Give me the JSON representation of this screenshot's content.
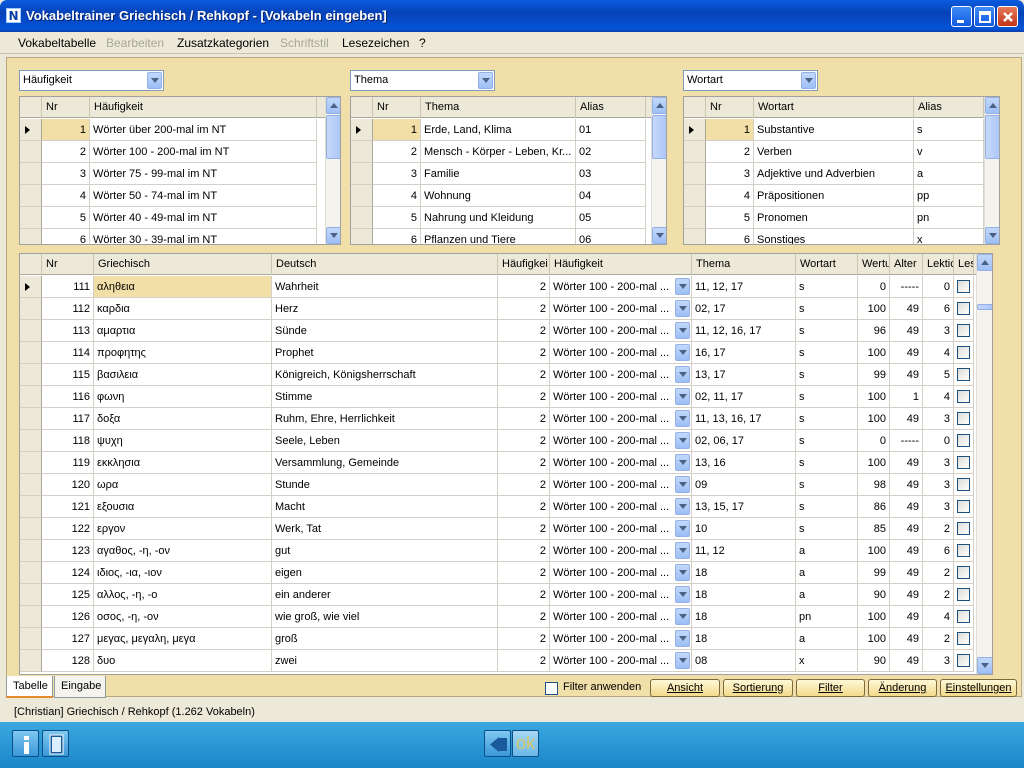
{
  "window": {
    "title": "Vokabeltrainer Griechisch / Rehkopf - [Vokabeln eingeben]",
    "icon": "app-n-icon"
  },
  "menu": [
    "Vokabeltabelle",
    "Bearbeiten",
    "Zusatzkategorien",
    "Schriftstil",
    "Lesezeichen",
    "?"
  ],
  "menu_disabled": [
    false,
    true,
    false,
    true,
    false,
    false
  ],
  "panels": [
    {
      "combo": "Häufigkeit",
      "headers": [
        "Nr",
        "Häufigkeit"
      ],
      "rows": [
        [
          "1",
          "Wörter über 200-mal im NT"
        ],
        [
          "2",
          "Wörter 100 - 200-mal im NT"
        ],
        [
          "3",
          "Wörter 75 - 99-mal im NT"
        ],
        [
          "4",
          "Wörter 50 - 74-mal im NT"
        ],
        [
          "5",
          "Wörter 40 - 49-mal im NT"
        ],
        [
          "6",
          "Wörter 30 - 39-mal im NT"
        ]
      ]
    },
    {
      "combo": "Thema",
      "headers": [
        "Nr",
        "Thema",
        "Alias"
      ],
      "rows": [
        [
          "1",
          "Erde, Land, Klima",
          "01"
        ],
        [
          "2",
          "Mensch - Körper - Leben, Kr...",
          "02"
        ],
        [
          "3",
          "Familie",
          "03"
        ],
        [
          "4",
          "Wohnung",
          "04"
        ],
        [
          "5",
          "Nahrung und Kleidung",
          "05"
        ],
        [
          "6",
          "Pflanzen und Tiere",
          "06"
        ]
      ]
    },
    {
      "combo": "Wortart",
      "headers": [
        "Nr",
        "Wortart",
        "Alias"
      ],
      "rows": [
        [
          "1",
          "Substantive",
          "s"
        ],
        [
          "2",
          "Verben",
          "v"
        ],
        [
          "3",
          "Adjektive und Adverbien",
          "a"
        ],
        [
          "4",
          "Präpositionen",
          "pp"
        ],
        [
          "5",
          "Pronomen",
          "pn"
        ],
        [
          "6",
          "Sonstiges",
          "x"
        ]
      ]
    }
  ],
  "main_grid": {
    "headers": [
      "Nr",
      "Griechisch",
      "Deutsch",
      "Häufigkei",
      "Häufigkeit",
      "Thema",
      "Wortart",
      "Wertu",
      "Alter",
      "Lektic",
      "Les"
    ],
    "rows": [
      [
        "111",
        "αληθεια",
        "Wahrheit",
        "2",
        "Wörter 100 - 200-mal ...",
        "11, 12, 17",
        "s",
        "0",
        "-----",
        "0"
      ],
      [
        "112",
        "καρδια",
        "Herz",
        "2",
        "Wörter 100 - 200-mal ...",
        "02, 17",
        "s",
        "100",
        "49",
        "6"
      ],
      [
        "113",
        "αμαρτια",
        "Sünde",
        "2",
        "Wörter 100 - 200-mal ...",
        "11, 12, 16, 17",
        "s",
        "96",
        "49",
        "3"
      ],
      [
        "114",
        "προφητης",
        "Prophet",
        "2",
        "Wörter 100 - 200-mal ...",
        "16, 17",
        "s",
        "100",
        "49",
        "4"
      ],
      [
        "115",
        "βασιλεια",
        "Königreich, Königsherrschaft",
        "2",
        "Wörter 100 - 200-mal ...",
        "13, 17",
        "s",
        "99",
        "49",
        "5"
      ],
      [
        "116",
        "φωνη",
        "Stimme",
        "2",
        "Wörter 100 - 200-mal ...",
        "02, 11, 17",
        "s",
        "100",
        "1",
        "4"
      ],
      [
        "117",
        "δοξα",
        "Ruhm, Ehre, Herrlichkeit",
        "2",
        "Wörter 100 - 200-mal ...",
        "11, 13, 16, 17",
        "s",
        "100",
        "49",
        "3"
      ],
      [
        "118",
        "ψυχη",
        "Seele, Leben",
        "2",
        "Wörter 100 - 200-mal ...",
        "02, 06, 17",
        "s",
        "0",
        "-----",
        "0"
      ],
      [
        "119",
        "εκκλησια",
        "Versammlung, Gemeinde",
        "2",
        "Wörter 100 - 200-mal ...",
        "13, 16",
        "s",
        "100",
        "49",
        "3"
      ],
      [
        "120",
        "ωρα",
        "Stunde",
        "2",
        "Wörter 100 - 200-mal ...",
        "09",
        "s",
        "98",
        "49",
        "3"
      ],
      [
        "121",
        "εξουσια",
        "Macht",
        "2",
        "Wörter 100 - 200-mal ...",
        "13, 15, 17",
        "s",
        "86",
        "49",
        "3"
      ],
      [
        "122",
        "εργον",
        "Werk, Tat",
        "2",
        "Wörter 100 - 200-mal ...",
        "10",
        "s",
        "85",
        "49",
        "2"
      ],
      [
        "123",
        "αγαθος, -η, -ον",
        "gut",
        "2",
        "Wörter 100 - 200-mal ...",
        "11, 12",
        "a",
        "100",
        "49",
        "6"
      ],
      [
        "124",
        "ιδιος, -ια, -ιον",
        "eigen",
        "2",
        "Wörter 100 - 200-mal ...",
        "18",
        "a",
        "99",
        "49",
        "2"
      ],
      [
        "125",
        "αλλος, -η, -ο",
        "ein anderer",
        "2",
        "Wörter 100 - 200-mal ...",
        "18",
        "a",
        "90",
        "49",
        "2"
      ],
      [
        "126",
        "οσος, -η, -ον",
        "wie groß, wie viel",
        "2",
        "Wörter 100 - 200-mal ...",
        "18",
        "pn",
        "100",
        "49",
        "4"
      ],
      [
        "127",
        "μεγας, μεγαλη, μεγα",
        "groß",
        "2",
        "Wörter 100 - 200-mal ...",
        "18",
        "a",
        "100",
        "49",
        "2"
      ],
      [
        "128",
        "δυο",
        "zwei",
        "2",
        "Wörter 100 - 200-mal ...",
        "08",
        "x",
        "90",
        "49",
        "3"
      ]
    ]
  },
  "tabs": [
    "Tabelle",
    "Eingabe"
  ],
  "filter_label": "Filter anwenden",
  "buttons": [
    "Ansicht",
    "Sortierung",
    "Filter",
    "Änderung",
    "Einstellungen"
  ],
  "status": "[Christian]  Griechisch / Rehkopf  (1.262 Vokabeln)",
  "bottom": {
    "ok_label": "ok",
    "icons": [
      "info-icon",
      "book-icon",
      "back-icon"
    ]
  },
  "colors": {
    "titlebar": "#0a5ce0",
    "content_bg": "#f0dfa8",
    "selected_cell": "#f2dfa7",
    "taskbar": "#1a86c8"
  }
}
